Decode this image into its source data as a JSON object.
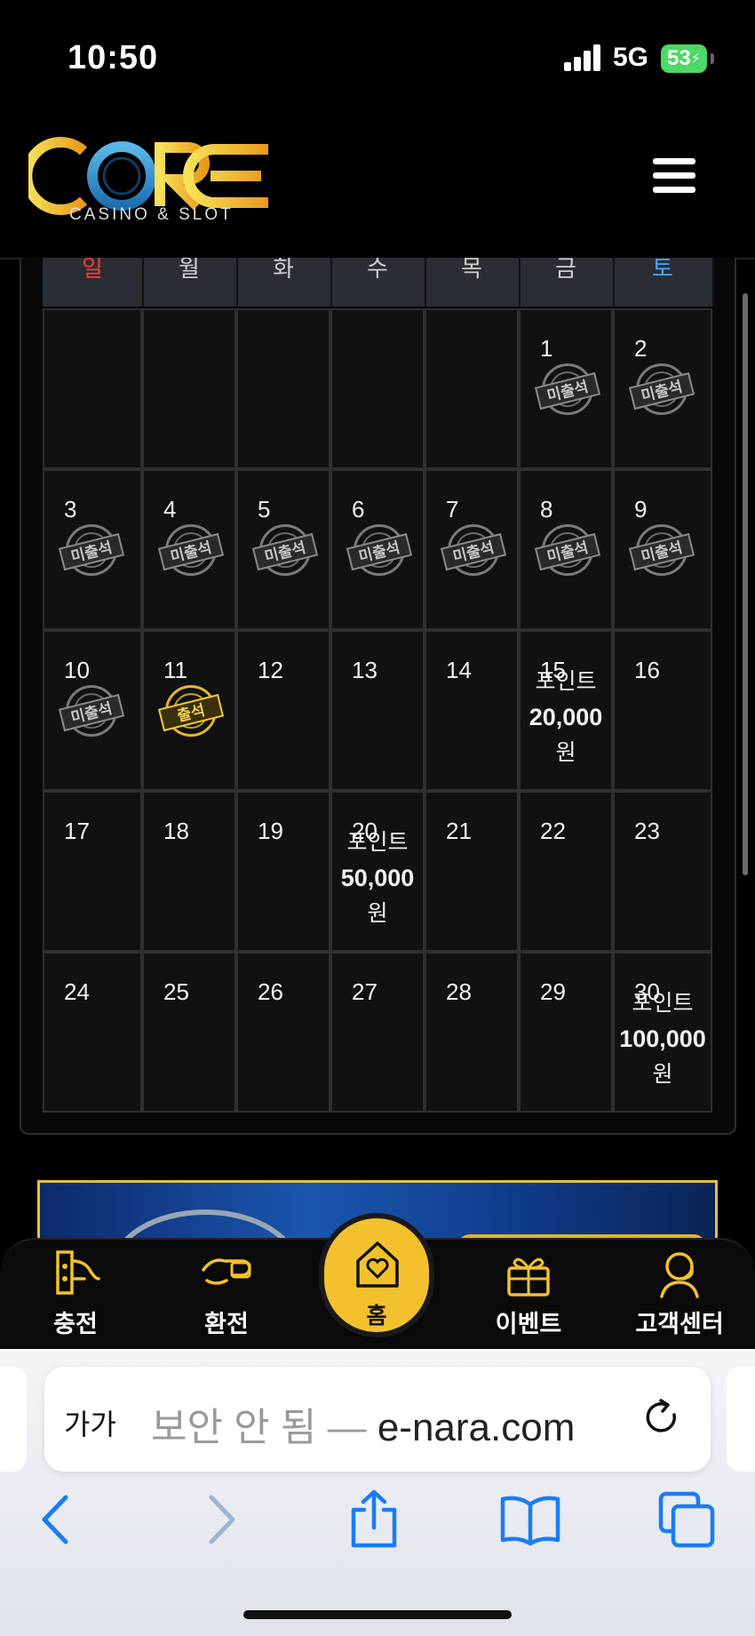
{
  "status_bar": {
    "time": "10:50",
    "network": "5G",
    "battery": "53"
  },
  "header": {
    "logo_text": "CORE",
    "logo_sub": "CASINO & SLOT"
  },
  "calendar": {
    "weekdays": [
      "일",
      "월",
      "화",
      "수",
      "목",
      "금",
      "토"
    ],
    "weekday_colors": {
      "sunday": "#ff3b30",
      "saturday": "#4ea7ff"
    },
    "stamp_missed": "미출석",
    "stamp_attended": "출석",
    "reward_label": "포인트",
    "reward_unit": "원",
    "days": [
      {
        "d": "1",
        "s": "missed"
      },
      {
        "d": "2",
        "s": "missed"
      },
      {
        "d": "3",
        "s": "missed"
      },
      {
        "d": "4",
        "s": "missed"
      },
      {
        "d": "5",
        "s": "missed"
      },
      {
        "d": "6",
        "s": "missed"
      },
      {
        "d": "7",
        "s": "missed"
      },
      {
        "d": "8",
        "s": "missed"
      },
      {
        "d": "9",
        "s": "missed"
      },
      {
        "d": "10",
        "s": "missed"
      },
      {
        "d": "11",
        "s": "attended"
      },
      {
        "d": "12"
      },
      {
        "d": "13"
      },
      {
        "d": "14"
      },
      {
        "d": "15",
        "reward": "20,000"
      },
      {
        "d": "16"
      },
      {
        "d": "17"
      },
      {
        "d": "18"
      },
      {
        "d": "19"
      },
      {
        "d": "20",
        "reward": "50,000"
      },
      {
        "d": "21"
      },
      {
        "d": "22"
      },
      {
        "d": "23"
      },
      {
        "d": "24"
      },
      {
        "d": "25"
      },
      {
        "d": "26"
      },
      {
        "d": "27"
      },
      {
        "d": "28"
      },
      {
        "d": "29"
      },
      {
        "d": "30",
        "reward": "100,000"
      }
    ]
  },
  "bottom_nav": {
    "deposit": "충전",
    "withdraw": "환전",
    "home": "홈",
    "event": "이벤트",
    "support": "고객센터"
  },
  "browser": {
    "aa": "가가",
    "url_prefix": "보안 안 됨 — ",
    "url_domain": "e-nara.com"
  },
  "colors": {
    "accent_gold": "#f3c12e",
    "ios_blue": "#1a7cf5"
  }
}
